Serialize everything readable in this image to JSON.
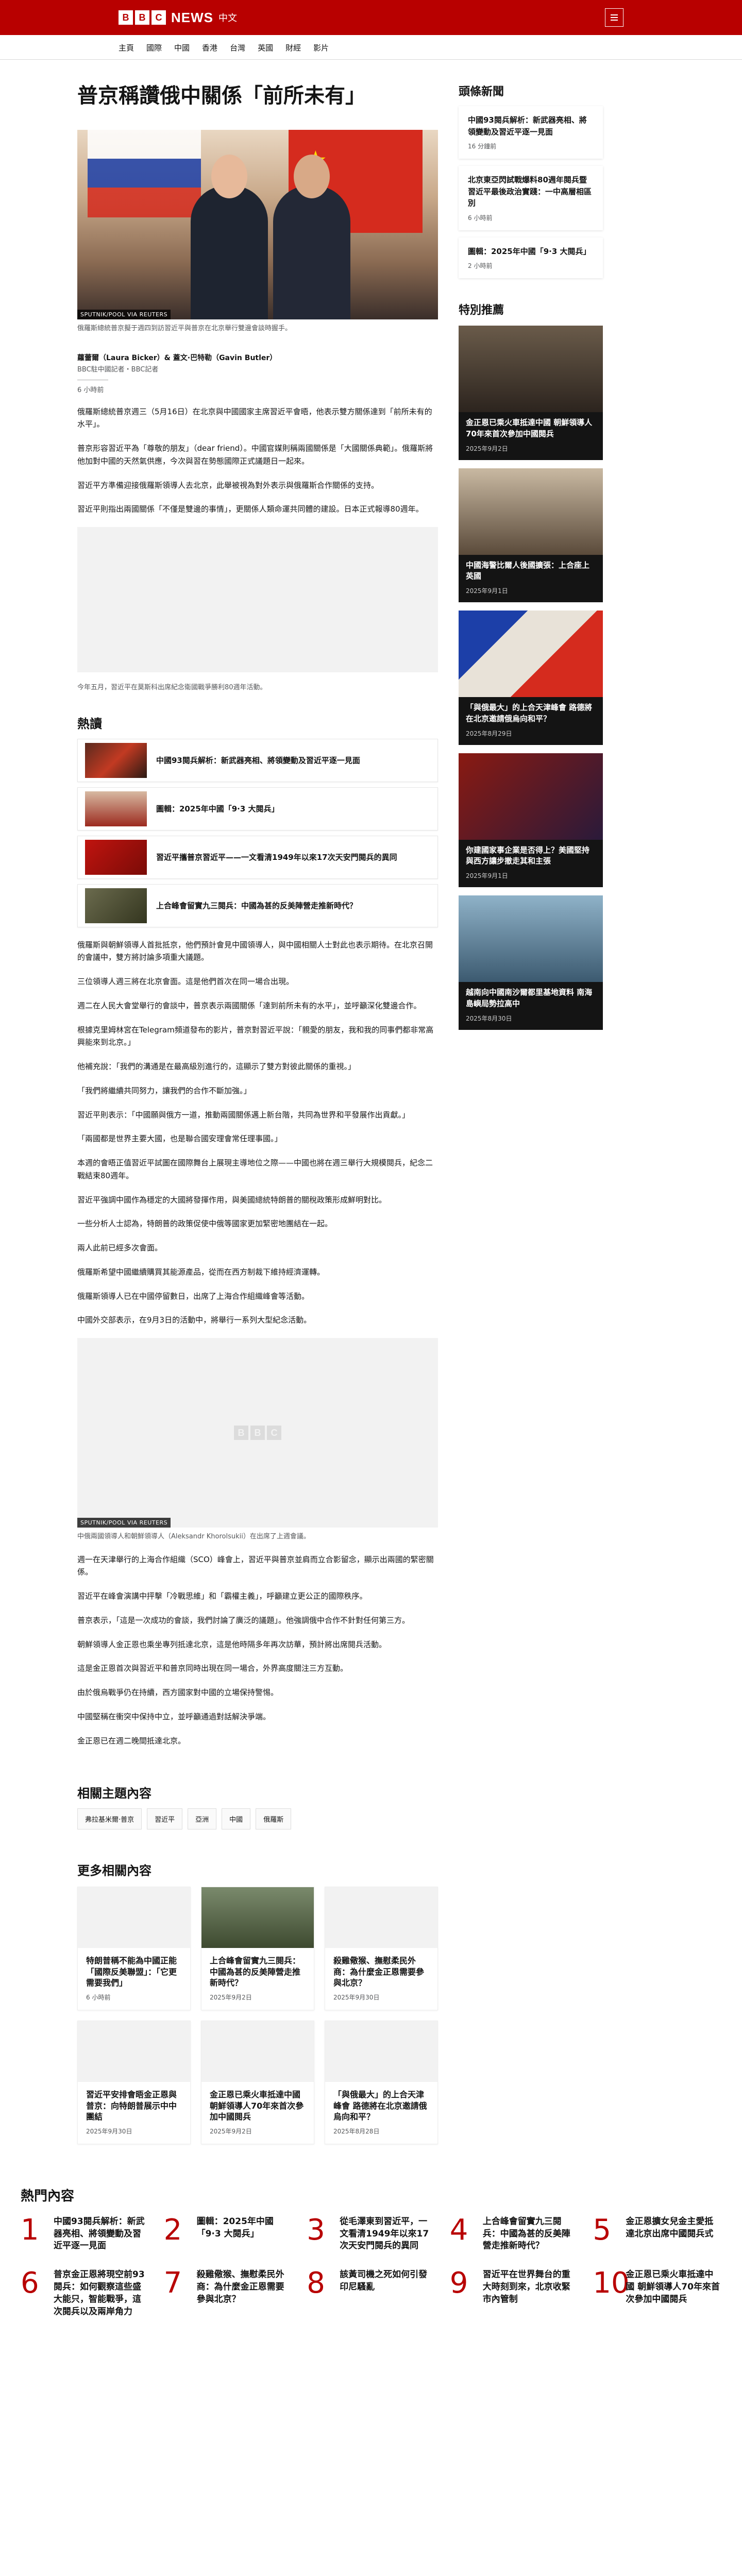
{
  "header": {
    "brand_letters": [
      "B",
      "B",
      "C"
    ],
    "brand_news": "NEWS",
    "brand_sub": "中文",
    "nav": [
      "主頁",
      "國際",
      "中國",
      "香港",
      "台灣",
      "英國",
      "財經",
      "影片"
    ]
  },
  "article": {
    "headline": "普京稱讚俄中關係「前所未有」",
    "hero_credit": "SPUTNIK/POOL VIA REUTERS",
    "hero_caption": "俄羅斯總統普京擬于週四到訪習近平與普京在北京舉行雙邊會談時握手。",
    "byline_names": "蘿蕾爾（Laura Bicker）& 蓋文·巴特勒（Gavin Butler）",
    "byline_role": "BBC駐中國記者・BBC記者",
    "time": "6 小時前",
    "paras_a": [
      "俄羅斯總統普京週三（5月16日）在北京與中國國家主席習近平會晤，他表示雙方關係達到「前所未有的水平」。",
      "普京形容習近平為「尊敬的朋友」（dear friend）。中國官媒則稱兩國關係是「大國關係典範」。俄羅斯將他加對中國的天然氣供應，今次與習在勢態國際正式議題日一起來。",
      "習近平方準備迎接俄羅斯領導人去北京，此舉被視為對外表示與俄羅斯合作關係的支持。",
      "習近平則指出兩國關係「不僅是雙邊的事情」，更關係人類命運共同體的建設。日本正式報導80週年。"
    ],
    "figure2_caption": "今年五月，習近平在莫斯科出席紀念衛國戰爭勝利80週年活動。",
    "hot_title": "熱讀",
    "hot_items": [
      "中國93閱兵解析：新武器亮相、將領變動及習近平逐一見面",
      "圖輯：2025年中國「9·3 大閱兵」",
      "習近平攜普京習近平——一文看清1949年以來17次天安門閱兵的異同",
      "上合峰會留實九三閱兵：中國為甚的反美陣營走推新時代？"
    ],
    "paras_b": [
      "俄羅斯與朝鮮領導人首批抵京，他們預計會見中國領導人，與中國相關人士對此也表示期待。在北京召開的會議中，雙方將討論多項重大議題。",
      "三位領導人週三將在北京會面。這是他們首次在同一場合出現。",
      "週二在人民大會堂舉行的會談中，普京表示兩國關係「達到前所未有的水平」，並呼籲深化雙邊合作。",
      "根據克里姆林宮在Telegram頻道發布的影片，普京對習近平說：「親愛的朋友，我和我的同事們都非常高興能來到北京。」",
      "他補充說：「我們的溝通是在最高級別進行的，這顯示了雙方對彼此關係的重視。」",
      "「我們將繼續共同努力，讓我們的合作不斷加強。」",
      "習近平則表示：「中國願與俄方一道，推動兩國關係邁上新台階，共同為世界和平發展作出貢獻。」",
      "「兩國都是世界主要大國，也是聯合國安理會常任理事國。」",
      "本週的會晤正值習近平試圖在國際舞台上展現主導地位之際——中國也將在週三舉行大規模閱兵，紀念二戰結束80週年。",
      "習近平強調中國作為穩定的大國將發揮作用，與美國總統特朗普的關稅政策形成鮮明對比。",
      "一些分析人士認為，特朗普的政策促使中俄等國家更加緊密地團結在一起。",
      "兩人此前已經多次會面。",
      "俄羅斯希望中國繼續購買其能源產品，從而在西方制裁下維持經濟運轉。",
      "俄羅斯領導人已在中國停留數日，出席了上海合作組織峰會等活動。",
      "中國外交部表示，在9月3日的活動中，將舉行一系列大型紀念活動。"
    ],
    "figure3_credit": "SPUTNIK/POOL VIA REUTERS",
    "figure3_caption": "中俄兩國領導人和朝鮮領導人（Aleksandr Khorolsukii）在出席了上週會議。",
    "paras_c": [
      "週一在天津舉行的上海合作組織（SCO）峰會上，習近平與普京並肩而立合影留念，顯示出兩國的緊密關係。",
      "習近平在峰會演講中抨擊「冷戰思維」和「霸權主義」，呼籲建立更公正的國際秩序。",
      "普京表示，「這是一次成功的會談，我們討論了廣泛的議題」。他強調俄中合作不針對任何第三方。",
      "朝鮮領導人金正恩也乘坐專列抵達北京，這是他時隔多年再次訪華，預計將出席閱兵活動。",
      "這是金正恩首次與習近平和普京同時出現在同一場合，外界高度關注三方互動。",
      "由於俄烏戰爭仍在持續，西方國家對中國的立場保持警惕。",
      "中國堅稱在衝突中保持中立，並呼籲通過對話解決爭端。",
      "金正恩已在週二晚間抵達北京。"
    ],
    "topics_title": "相關主題內容",
    "topics": [
      "弗拉基米爾·普京",
      "習近平",
      "亞洲",
      "中國",
      "俄羅斯"
    ],
    "more_title": "更多相關內容",
    "more": [
      {
        "title": "特朗普稱不能為中國正能「國際反美聯盟」：「它更需要我們」",
        "date": "6 小時前"
      },
      {
        "title": "上合峰會留實九三閱兵：中國為甚的反美陣營走推新時代？",
        "date": "2025年9月2日"
      },
      {
        "title": "殺雞儆猴、撫慰柔民外商：為什麼金正恩需要參與北京？",
        "date": "2025年9月30日"
      },
      {
        "title": "習近平安排會晤金正恩與普京：向特朗普展示中中團結",
        "date": "2025年9月30日"
      },
      {
        "title": "金正恩已乘火車抵達中國 朝鮮領導人70年來首次參加中國閱兵",
        "date": "2025年9月2日"
      },
      {
        "title": "「與俄最大」的上合天津峰會 路德將在北京邀請俄烏向和平？",
        "date": "2025年8月28日"
      }
    ]
  },
  "sidebar": {
    "headlines_title": "頭條新聞",
    "headlines": [
      {
        "title": "中國93閱兵解析：新武器亮相、將領變動及習近平逐一見面",
        "time": "16 分鐘前"
      },
      {
        "title": "北京東亞閃試戰爆料80週年閱兵暨習近平最後政治實踐：一中高層相區別",
        "time": "6 小時前"
      },
      {
        "title": "圖輯：2025年中國「9·3 大閱兵」",
        "time": "2 小時前"
      }
    ],
    "featured_title": "特別推薦",
    "featured": [
      {
        "title": "金正恩已乘火車抵達中國 朝鮮領導人70年來首次參加中國閱兵",
        "date": "2025年9月2日"
      },
      {
        "title": "中國海警比爾人後國擴張：上合座上英國",
        "date": "2025年9月1日"
      },
      {
        "title": "「與俄最大」的上合天津峰會 路德將在北京邀請俄烏向和平？",
        "date": "2025年8月29日"
      },
      {
        "title": "你建國家事企業是否得上？美國堅持與西方讓步撤走其和主張",
        "date": "2025年9月1日"
      },
      {
        "title": "越南向中國南沙爾都里基地資料 南海島嶼局勢拉高中",
        "date": "2025年8月30日"
      }
    ]
  },
  "mostread": {
    "title": "熱門內容",
    "items": [
      {
        "num": "1",
        "title": "中國93閱兵解析：新武器亮相、將領變動及習近平逐一見面"
      },
      {
        "num": "2",
        "title": "圖輯：2025年中國「9·3 大閱兵」"
      },
      {
        "num": "3",
        "title": "從毛澤東到習近平，一文看清1949年以來17次天安門閱兵的異同"
      },
      {
        "num": "4",
        "title": "上合峰會留實九三閱兵：中國為甚的反美陣營走推新時代？"
      },
      {
        "num": "5",
        "title": "金正恩擴女兒金主愛抵達北京出席中國閱兵式"
      },
      {
        "num": "6",
        "title": "普京金正恩將現空前93閱兵：如何觀察這些盛大能只，智能戰爭，這次閱兵以及兩岸角力"
      },
      {
        "num": "7",
        "title": "殺雞儆猴、撫慰柔民外商：為什麼金正恩需要參與北京？"
      },
      {
        "num": "8",
        "title": "該黃司機之死如何引發印尼騷亂"
      },
      {
        "num": "9",
        "title": "習近平在世界舞台的重大時刻到來，北京收緊市內管制"
      },
      {
        "num": "10",
        "title": "金正恩已乘火車抵達中國 朝鮮領導人70年來首次參加中國閱兵"
      }
    ]
  },
  "colors": {
    "brand": "#b80000",
    "text": "#141414",
    "muted": "#545658"
  }
}
